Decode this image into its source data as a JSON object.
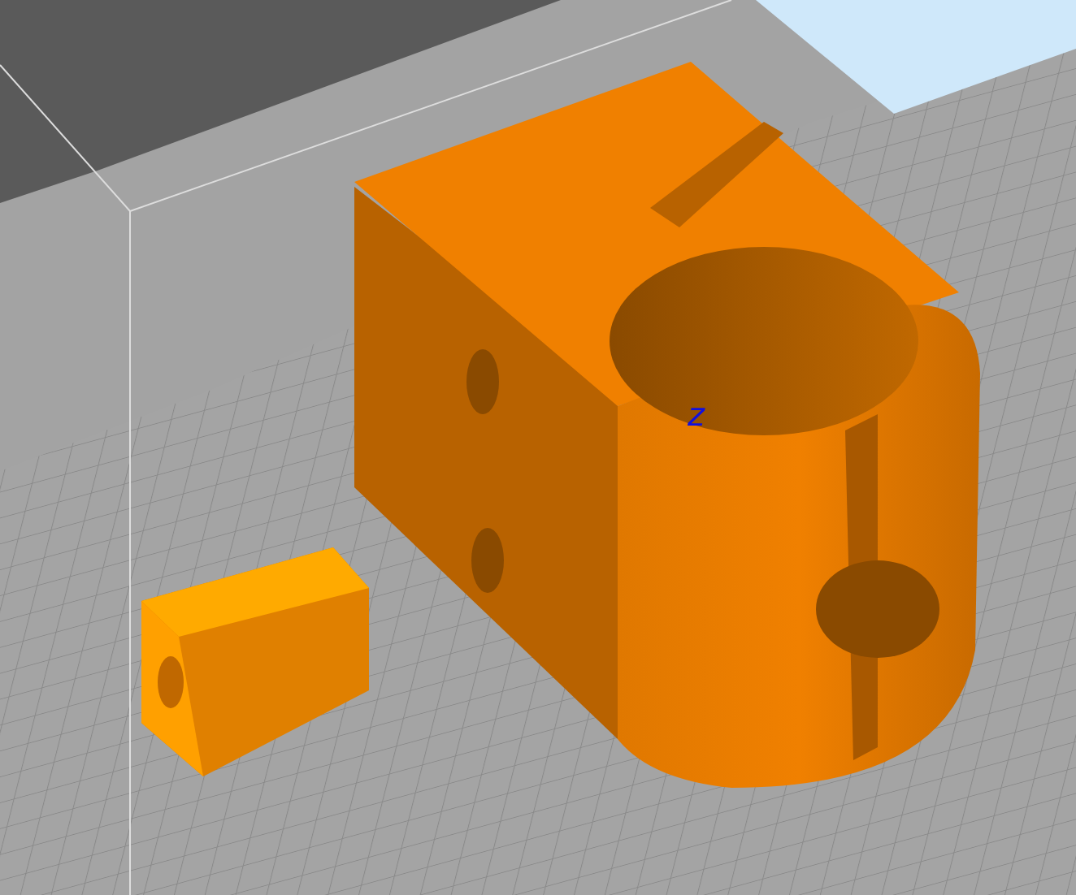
{
  "viewport": {
    "axis_label": "z"
  }
}
